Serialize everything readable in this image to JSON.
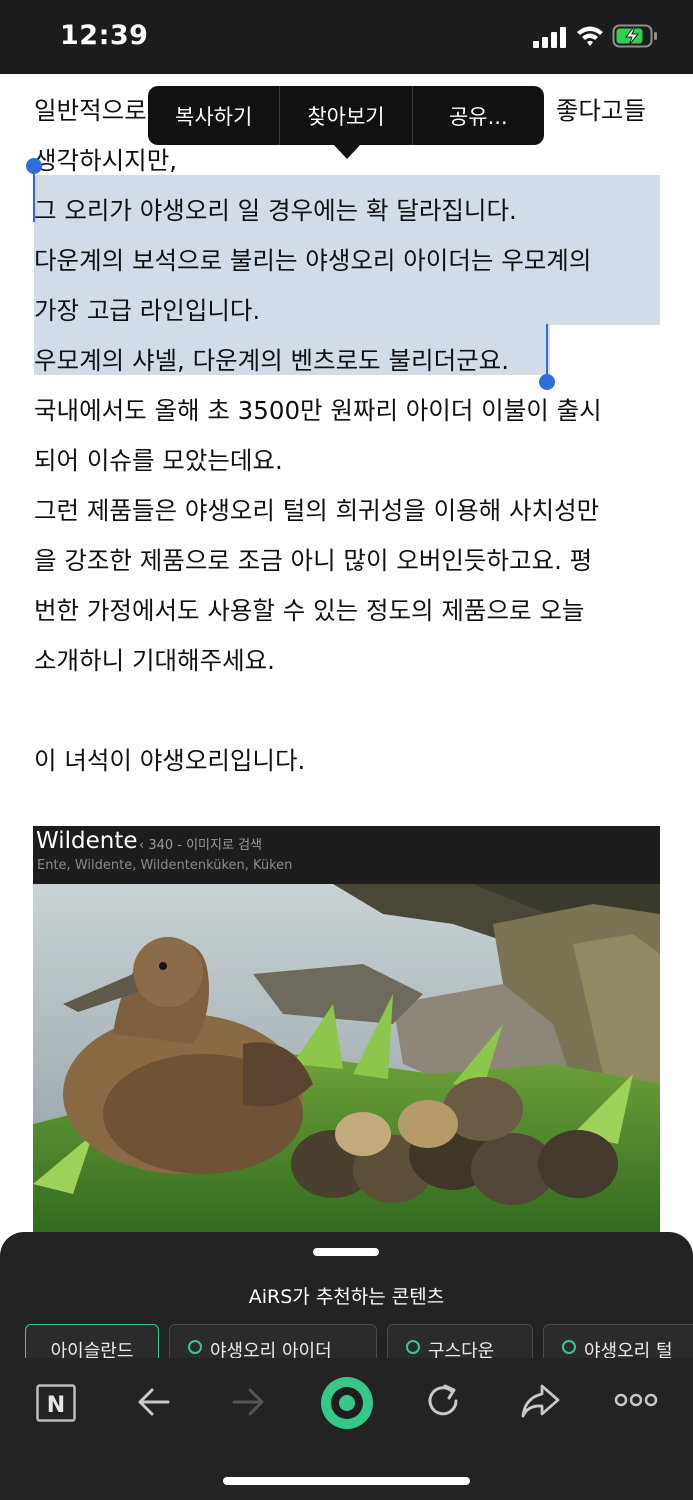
{
  "status_bar": {
    "time": "12:39"
  },
  "context_menu": {
    "items": [
      "복사하기",
      "찾아보기",
      "공유..."
    ]
  },
  "article": {
    "lines": [
      "일반적으로",
      "좋다고들",
      "생각하시지만,",
      "그 오리가 야생오리 일 경우에는 확 달라집니다.",
      "다운계의 보석으로 불리는 야생오리 아이더는 우모계의",
      "가장 고급 라인입니다.",
      "우모계의 샤넬, 다운계의 벤츠로도 불리더군요.",
      "국내에서도 올해 초 3500만 원짜리 아이더 이불이 출시",
      "되어 이슈를 모았는데요.",
      "그런 제품들은 야생오리 털의 희귀성을 이용해 사치성만",
      "을 강조한 제품으로 조금  아니 많이 오버인듯하고요. 평",
      "번한 가정에서도 사용할 수 있는 정도의  제품으로 오늘",
      "소개하니 기대해주세요.",
      "이 녀석이 야생오리입니다."
    ]
  },
  "image": {
    "title": "Wildente",
    "count": "‹ 340 - 이미지로 검색",
    "tags": "Ente, Wildente, Wildentenküken, Küken"
  },
  "bottom_sheet": {
    "title": "AiRS가 추천하는 콘텐츠",
    "chips": [
      "아이슬란드",
      "야생오리 아이더",
      "구스다운",
      "야생오리 털"
    ]
  },
  "toolbar": {
    "items": [
      "naver-home",
      "back",
      "forward",
      "green-dot-menu",
      "refresh",
      "share",
      "more"
    ],
    "logo_letter": "N"
  },
  "colors": {
    "selection": "#d2dce9",
    "handle": "#2e6ed8",
    "accent_green": "#35c889",
    "dark_bg": "#232323"
  }
}
